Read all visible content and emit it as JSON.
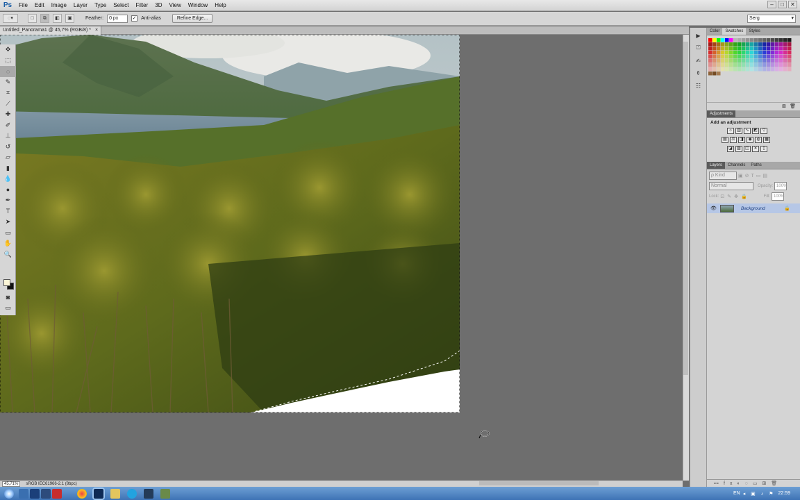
{
  "app": {
    "logo": "Ps",
    "menu": [
      "File",
      "Edit",
      "Image",
      "Layer",
      "Type",
      "Select",
      "Filter",
      "3D",
      "View",
      "Window",
      "Help"
    ],
    "window_controls": [
      "–",
      "□",
      "✕"
    ]
  },
  "options": {
    "feather_label": "Feather:",
    "feather_value": "0 px",
    "antialias_label": "Anti-alias",
    "antialias_checked": true,
    "refine_edge": "Refine Edge...",
    "workspace": "Serg"
  },
  "document": {
    "tab_title": "Untitled_Panorama1 @ 45,7% (RGB/8) *",
    "tab_close": "×"
  },
  "status": {
    "zoom": "45,71%",
    "profile": "sRGB IEC61966-2.1 (8bpc)"
  },
  "panels": {
    "color_tabs": [
      "Color",
      "Swatches",
      "Styles"
    ],
    "color_active": "Swatches",
    "adjustments_tab": "Adjustments",
    "add_adjustment": "Add an adjustment",
    "layers_tabs": [
      "Layers",
      "Channels",
      "Paths"
    ],
    "layers_active": "Layers",
    "kind_label": "ρ Kind",
    "blend_mode": "Normal",
    "opacity_label": "Opacity:",
    "opacity_value": "100%",
    "lock_label": "Lock:",
    "fill_label": "Fill:",
    "fill_value": "100%",
    "layer_name": "Background"
  },
  "taskbar": {
    "lang": "EN",
    "time": "22:59"
  },
  "colors": {
    "accent": "#1c5ea6",
    "canvas_bg": "#6e6e6e",
    "selected_layer": "#b6c7e6"
  }
}
